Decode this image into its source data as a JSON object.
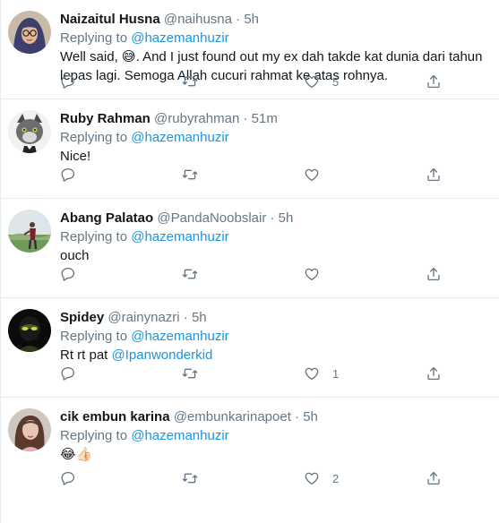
{
  "reply_prefix": "Replying to",
  "tweets": [
    {
      "name": "Naizaitul Husna",
      "handle": "@naihusna",
      "dot": "·",
      "time": "5h",
      "reply_to": "@hazemanhuzir",
      "text_before": "Well said,",
      "emoji": "😅",
      "text_after": ". And I just found out my ex dah takde kat dunia dari tahun lepas lagi. Semoga Allah cucuri rahmat ke atas rohnya.",
      "like_count": "5",
      "avatar_icon": "woman-hijab-glasses-avatar"
    },
    {
      "name": "Ruby Rahman",
      "handle": "@rubyrahman",
      "dot": "·",
      "time": "51m",
      "reply_to": "@hazemanhuzir",
      "text": "Nice!",
      "like_count": "",
      "avatar_icon": "cat-avatar"
    },
    {
      "name": "Abang Palatao",
      "handle": "@PandaNoobslair",
      "dot": "·",
      "time": "5h",
      "reply_to": "@hazemanhuzir",
      "text": "ouch",
      "like_count": "",
      "avatar_icon": "landscape-avatar"
    },
    {
      "name": "Spidey",
      "handle": "@rainynazri",
      "dot": "·",
      "time": "5h",
      "reply_to": "@hazemanhuzir",
      "text": "Rt rt pat",
      "mention": "@Ipanwonderkid",
      "like_count": "1",
      "avatar_icon": "masked-face-avatar"
    },
    {
      "name": "cik embun karina",
      "handle": "@embunkarinapoet",
      "dot": "·",
      "time": "5h",
      "reply_to": "@hazemanhuzir",
      "text": "😂👍🏻",
      "like_count": "2",
      "avatar_icon": "woman-portrait-avatar"
    }
  ],
  "action_icons": [
    "reply-icon",
    "retweet-icon",
    "like-icon",
    "share-icon"
  ],
  "colors": {
    "link": "#1b95e0",
    "muted": "#657786",
    "divider": "#e6ecf0"
  }
}
